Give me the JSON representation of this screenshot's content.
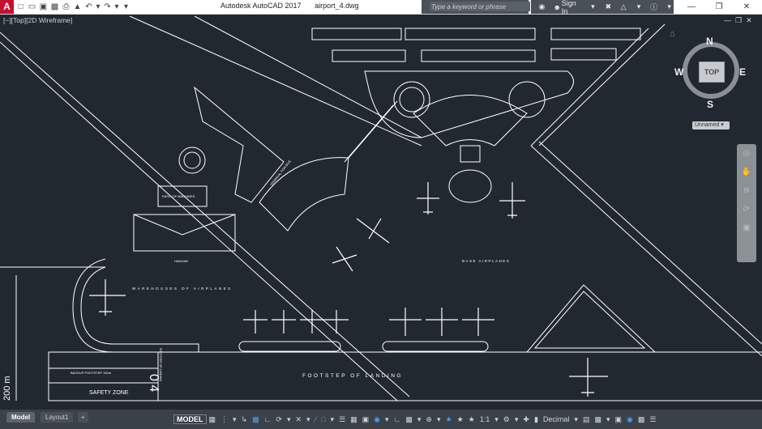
{
  "app": {
    "logo": "A",
    "title": "Autodesk AutoCAD 2017",
    "filename": "airport_4.dwg"
  },
  "qat_icons": [
    "new-icon",
    "open-icon",
    "save-icon",
    "saveas-icon",
    "print-icon",
    "publish-icon",
    "undo-icon",
    "redo-icon"
  ],
  "search": {
    "placeholder": "Type a keyword or phrase"
  },
  "account": {
    "signin_label": "Sign In"
  },
  "viewport": {
    "label": "[−][Top][2D Wireframe]"
  },
  "viewcube": {
    "top_label": "TOP",
    "north": "N",
    "south": "S",
    "east": "E",
    "west": "W"
  },
  "ucs": {
    "label": "Unnamed"
  },
  "drawing": {
    "labels": {
      "terminal": "TERMINAL FOR BUS",
      "hangar": "HANGAR",
      "patio": "PATIO OF MACHINES",
      "warehouses": "WAREHOUSES OF AIRPLANES",
      "base_airplanes": "BASE AIRPLANES",
      "footstep": "FOOTSTEP OF LANDING",
      "backup": "BACKUP FOOTSTEP 100m",
      "safety_zone": "SAFETY ZONE",
      "runway_number": "0 4",
      "dimension": "200 m",
      "runway_side": "FOOTSTEP OF LANDING"
    }
  },
  "status": {
    "tabs": [
      {
        "label": "Model"
      },
      {
        "label": "Layout1"
      },
      {
        "label": "+"
      }
    ],
    "model_label": "MODEL",
    "units_label": "Decimal",
    "scale_label": "1:1"
  },
  "colors": {
    "background": "#212830",
    "lines": "#ffffff",
    "accent_blue": "#45a1ff",
    "titlebar": "#ffffff",
    "statusbar": "#3b4148"
  }
}
